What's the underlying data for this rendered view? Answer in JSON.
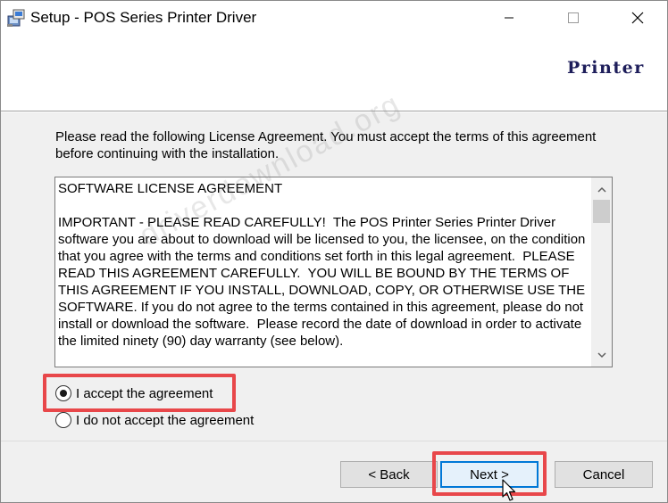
{
  "window": {
    "title": "Setup - POS Series Printer Driver",
    "minimize_icon": "minimize-icon",
    "maximize_icon": "maximize-icon",
    "close_icon": "close-icon"
  },
  "header": {
    "logo_text": "Printer"
  },
  "intro": "Please read the following License Agreement. You must accept the terms of this agreement before continuing with the installation.",
  "license": {
    "heading": "SOFTWARE LICENSE AGREEMENT",
    "body": "IMPORTANT - PLEASE READ CAREFULLY!  The POS Printer Series Printer Driver software you are about to download will be licensed to you, the licensee, on the condition that you agree with the terms and conditions set forth in this legal agreement.  PLEASE READ THIS AGREEMENT CAREFULLY.  YOU WILL BE BOUND BY THE TERMS OF THIS AGREEMENT IF YOU INSTALL, DOWNLOAD, COPY, OR OTHERWISE USE THE SOFTWARE. If you do not agree to the terms contained in this agreement, please do not install or download the software.  Please record the date of download in order to activate the limited ninety (90) day warranty (see below)."
  },
  "options": {
    "accept_label": "I accept the agreement",
    "decline_label": "I do not accept the agreement",
    "selected": "accept"
  },
  "buttons": {
    "back": "< Back",
    "next": "Next >",
    "cancel": "Cancel"
  },
  "watermark": "driverdownload.org",
  "colors": {
    "highlight": "#e8474a",
    "focus_border": "#0078d7"
  }
}
